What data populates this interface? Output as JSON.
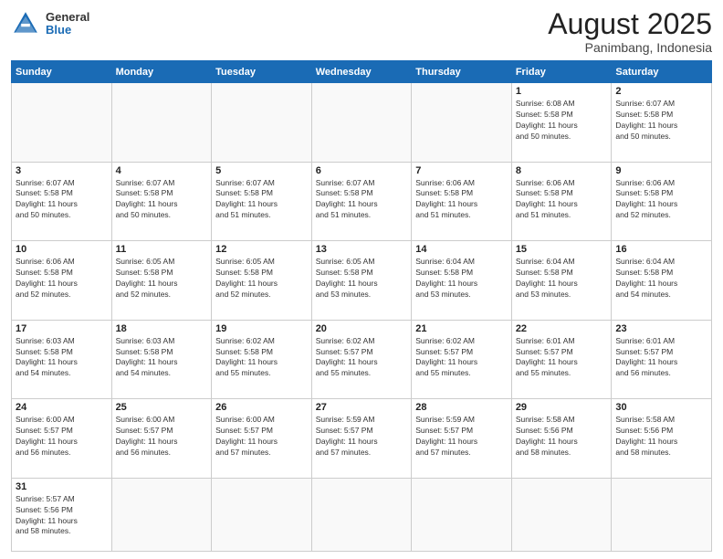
{
  "header": {
    "logo_general": "General",
    "logo_blue": "Blue",
    "month_title": "August 2025",
    "location": "Panimbang, Indonesia"
  },
  "days_of_week": [
    "Sunday",
    "Monday",
    "Tuesday",
    "Wednesday",
    "Thursday",
    "Friday",
    "Saturday"
  ],
  "weeks": [
    [
      {
        "day": "",
        "info": ""
      },
      {
        "day": "",
        "info": ""
      },
      {
        "day": "",
        "info": ""
      },
      {
        "day": "",
        "info": ""
      },
      {
        "day": "",
        "info": ""
      },
      {
        "day": "1",
        "info": "Sunrise: 6:08 AM\nSunset: 5:58 PM\nDaylight: 11 hours\nand 50 minutes."
      },
      {
        "day": "2",
        "info": "Sunrise: 6:07 AM\nSunset: 5:58 PM\nDaylight: 11 hours\nand 50 minutes."
      }
    ],
    [
      {
        "day": "3",
        "info": "Sunrise: 6:07 AM\nSunset: 5:58 PM\nDaylight: 11 hours\nand 50 minutes."
      },
      {
        "day": "4",
        "info": "Sunrise: 6:07 AM\nSunset: 5:58 PM\nDaylight: 11 hours\nand 50 minutes."
      },
      {
        "day": "5",
        "info": "Sunrise: 6:07 AM\nSunset: 5:58 PM\nDaylight: 11 hours\nand 51 minutes."
      },
      {
        "day": "6",
        "info": "Sunrise: 6:07 AM\nSunset: 5:58 PM\nDaylight: 11 hours\nand 51 minutes."
      },
      {
        "day": "7",
        "info": "Sunrise: 6:06 AM\nSunset: 5:58 PM\nDaylight: 11 hours\nand 51 minutes."
      },
      {
        "day": "8",
        "info": "Sunrise: 6:06 AM\nSunset: 5:58 PM\nDaylight: 11 hours\nand 51 minutes."
      },
      {
        "day": "9",
        "info": "Sunrise: 6:06 AM\nSunset: 5:58 PM\nDaylight: 11 hours\nand 52 minutes."
      }
    ],
    [
      {
        "day": "10",
        "info": "Sunrise: 6:06 AM\nSunset: 5:58 PM\nDaylight: 11 hours\nand 52 minutes."
      },
      {
        "day": "11",
        "info": "Sunrise: 6:05 AM\nSunset: 5:58 PM\nDaylight: 11 hours\nand 52 minutes."
      },
      {
        "day": "12",
        "info": "Sunrise: 6:05 AM\nSunset: 5:58 PM\nDaylight: 11 hours\nand 52 minutes."
      },
      {
        "day": "13",
        "info": "Sunrise: 6:05 AM\nSunset: 5:58 PM\nDaylight: 11 hours\nand 53 minutes."
      },
      {
        "day": "14",
        "info": "Sunrise: 6:04 AM\nSunset: 5:58 PM\nDaylight: 11 hours\nand 53 minutes."
      },
      {
        "day": "15",
        "info": "Sunrise: 6:04 AM\nSunset: 5:58 PM\nDaylight: 11 hours\nand 53 minutes."
      },
      {
        "day": "16",
        "info": "Sunrise: 6:04 AM\nSunset: 5:58 PM\nDaylight: 11 hours\nand 54 minutes."
      }
    ],
    [
      {
        "day": "17",
        "info": "Sunrise: 6:03 AM\nSunset: 5:58 PM\nDaylight: 11 hours\nand 54 minutes."
      },
      {
        "day": "18",
        "info": "Sunrise: 6:03 AM\nSunset: 5:58 PM\nDaylight: 11 hours\nand 54 minutes."
      },
      {
        "day": "19",
        "info": "Sunrise: 6:02 AM\nSunset: 5:58 PM\nDaylight: 11 hours\nand 55 minutes."
      },
      {
        "day": "20",
        "info": "Sunrise: 6:02 AM\nSunset: 5:57 PM\nDaylight: 11 hours\nand 55 minutes."
      },
      {
        "day": "21",
        "info": "Sunrise: 6:02 AM\nSunset: 5:57 PM\nDaylight: 11 hours\nand 55 minutes."
      },
      {
        "day": "22",
        "info": "Sunrise: 6:01 AM\nSunset: 5:57 PM\nDaylight: 11 hours\nand 55 minutes."
      },
      {
        "day": "23",
        "info": "Sunrise: 6:01 AM\nSunset: 5:57 PM\nDaylight: 11 hours\nand 56 minutes."
      }
    ],
    [
      {
        "day": "24",
        "info": "Sunrise: 6:00 AM\nSunset: 5:57 PM\nDaylight: 11 hours\nand 56 minutes."
      },
      {
        "day": "25",
        "info": "Sunrise: 6:00 AM\nSunset: 5:57 PM\nDaylight: 11 hours\nand 56 minutes."
      },
      {
        "day": "26",
        "info": "Sunrise: 6:00 AM\nSunset: 5:57 PM\nDaylight: 11 hours\nand 57 minutes."
      },
      {
        "day": "27",
        "info": "Sunrise: 5:59 AM\nSunset: 5:57 PM\nDaylight: 11 hours\nand 57 minutes."
      },
      {
        "day": "28",
        "info": "Sunrise: 5:59 AM\nSunset: 5:57 PM\nDaylight: 11 hours\nand 57 minutes."
      },
      {
        "day": "29",
        "info": "Sunrise: 5:58 AM\nSunset: 5:56 PM\nDaylight: 11 hours\nand 58 minutes."
      },
      {
        "day": "30",
        "info": "Sunrise: 5:58 AM\nSunset: 5:56 PM\nDaylight: 11 hours\nand 58 minutes."
      }
    ],
    [
      {
        "day": "31",
        "info": "Sunrise: 5:57 AM\nSunset: 5:56 PM\nDaylight: 11 hours\nand 58 minutes."
      },
      {
        "day": "",
        "info": ""
      },
      {
        "day": "",
        "info": ""
      },
      {
        "day": "",
        "info": ""
      },
      {
        "day": "",
        "info": ""
      },
      {
        "day": "",
        "info": ""
      },
      {
        "day": "",
        "info": ""
      }
    ]
  ]
}
